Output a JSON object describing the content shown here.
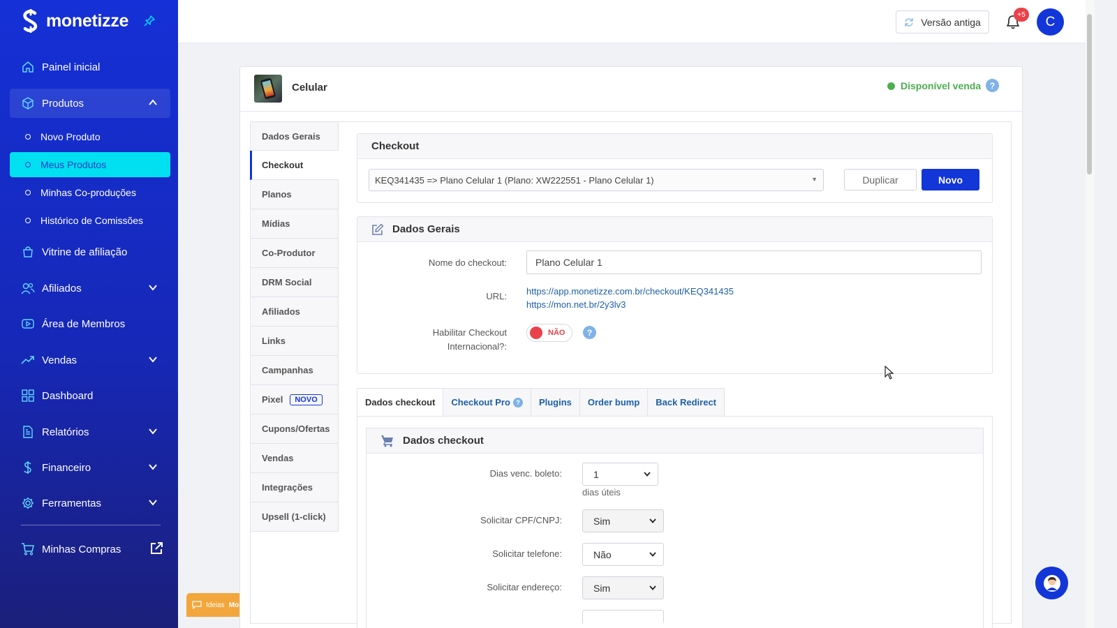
{
  "app": {
    "brand": "monetizze"
  },
  "sidebar": {
    "items": [
      {
        "label": "Painel inicial"
      },
      {
        "label": "Produtos"
      },
      {
        "label": "Vitrine de afiliação"
      },
      {
        "label": "Afiliados"
      },
      {
        "label": "Área de Membros"
      },
      {
        "label": "Vendas"
      },
      {
        "label": "Dashboard"
      },
      {
        "label": "Relatórios"
      },
      {
        "label": "Financeiro"
      },
      {
        "label": "Ferramentas"
      },
      {
        "label": "Minhas Compras"
      }
    ],
    "sub_items": [
      {
        "label": "Novo Produto"
      },
      {
        "label": "Meus Produtos"
      },
      {
        "label": "Minhas Co-produções"
      },
      {
        "label": "Histórico de Comissões"
      }
    ],
    "ideias_prefix": "Ideias",
    "ideias_brand": "Monetizze"
  },
  "topbar": {
    "old_version_label": "Versão antiga",
    "notifications_badge": "+5",
    "avatar_letter": "C"
  },
  "product": {
    "name": "Celular",
    "status": "Disponível venda",
    "help": "?"
  },
  "vertical_tabs": [
    {
      "label": "Dados Gerais"
    },
    {
      "label": "Checkout"
    },
    {
      "label": "Planos"
    },
    {
      "label": "Mídias"
    },
    {
      "label": "Co-Produtor"
    },
    {
      "label": "DRM Social"
    },
    {
      "label": "Afiliados"
    },
    {
      "label": "Links"
    },
    {
      "label": "Campanhas"
    },
    {
      "label": "Pixel",
      "badge": "NOVO"
    },
    {
      "label": "Cupons/Ofertas"
    },
    {
      "label": "Vendas"
    },
    {
      "label": "Integrações"
    },
    {
      "label": "Upsell (1-click)"
    }
  ],
  "checkout": {
    "title": "Checkout",
    "selected": "KEQ341435 => Plano Celular 1 (Plano: XW222551 - Plano Celular 1)",
    "duplicate_label": "Duplicar",
    "new_label": "Novo"
  },
  "general": {
    "title": "Dados Gerais",
    "name_label": "Nome do checkout:",
    "name_value": "Plano Celular 1",
    "url_label": "URL:",
    "url_1": "https://app.monetizze.com.br/checkout/KEQ341435",
    "url_2": "https://mon.net.br/2y3lv3",
    "intl_label_1": "Habilitar Checkout",
    "intl_label_2": "Internacional?:",
    "intl_value": "NÃO"
  },
  "h_tabs": [
    {
      "label": "Dados checkout"
    },
    {
      "label": "Checkout Pro"
    },
    {
      "label": "Plugins"
    },
    {
      "label": "Order bump"
    },
    {
      "label": "Back Redirect"
    }
  ],
  "dados_checkout": {
    "title": "Dados checkout",
    "boleto_label": "Dias venc. boleto:",
    "boleto_value": "1",
    "boleto_hint": "dias úteis",
    "cpf_label": "Solicitar CPF/CNPJ:",
    "cpf_value": "Sim",
    "phone_label": "Solicitar telefone:",
    "phone_value": "Não",
    "address_label": "Solicitar endereço:",
    "address_value": "Sim"
  },
  "colors": {
    "primary": "#1236d8",
    "active_sub": "#00e0f0",
    "success": "#4caf50",
    "danger": "#e9424b",
    "link": "#1c5fa8"
  }
}
